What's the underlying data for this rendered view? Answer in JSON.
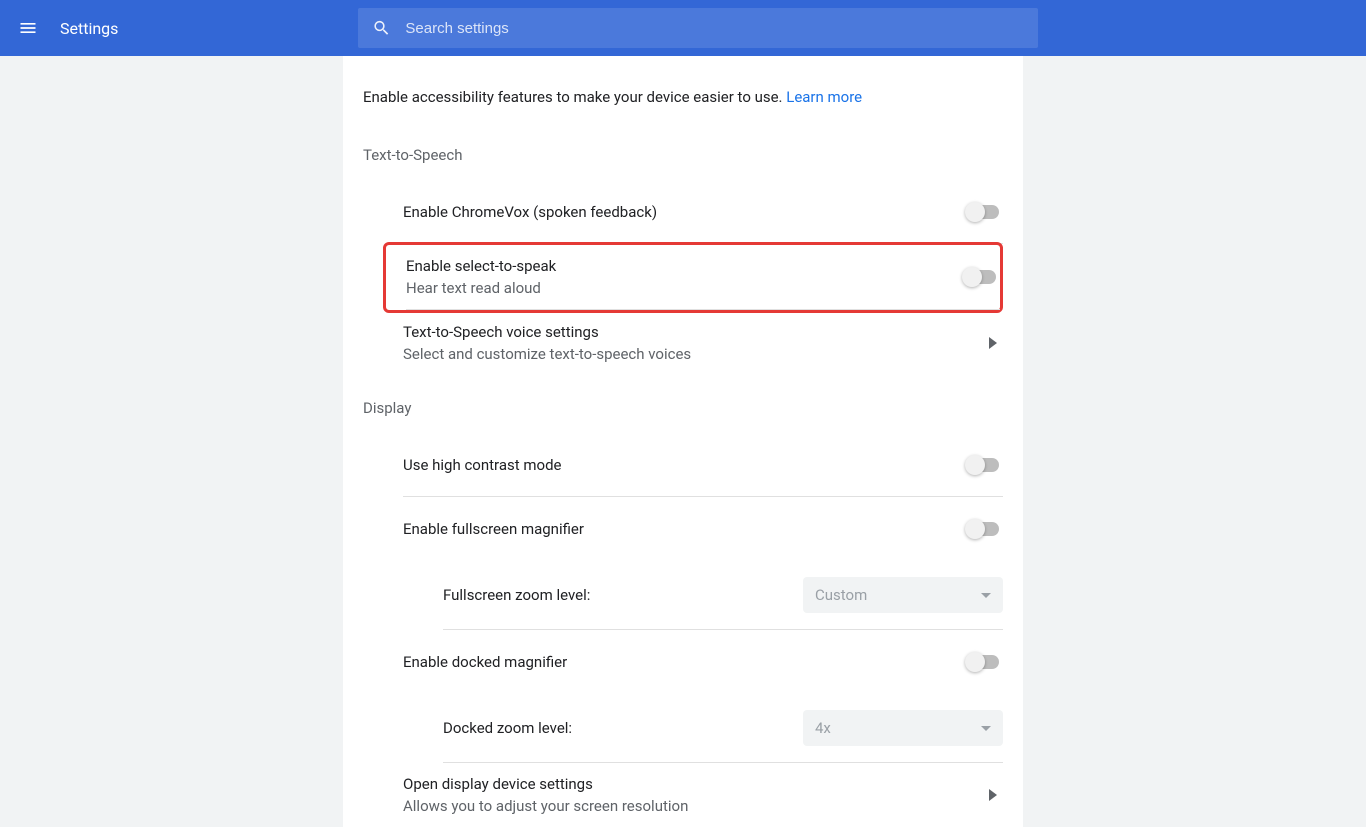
{
  "header": {
    "title": "Settings",
    "search_placeholder": "Search settings"
  },
  "intro": {
    "text": "Enable accessibility features to make your device easier to use. ",
    "link": "Learn more"
  },
  "sections": {
    "tts": {
      "heading": "Text-to-Speech",
      "chromevox": {
        "label": "Enable ChromeVox (spoken feedback)"
      },
      "select_to_speak": {
        "label": "Enable select-to-speak",
        "sub": "Hear text read aloud"
      },
      "voice_settings": {
        "label": "Text-to-Speech voice settings",
        "sub": "Select and customize text-to-speech voices"
      }
    },
    "display": {
      "heading": "Display",
      "high_contrast": {
        "label": "Use high contrast mode"
      },
      "fullscreen_magnifier": {
        "label": "Enable fullscreen magnifier"
      },
      "fullscreen_zoom": {
        "label": "Fullscreen zoom level:",
        "value": "Custom"
      },
      "docked_magnifier": {
        "label": "Enable docked magnifier"
      },
      "docked_zoom": {
        "label": "Docked zoom level:",
        "value": "4x"
      },
      "display_settings": {
        "label": "Open display device settings",
        "sub": "Allows you to adjust your screen resolution"
      }
    }
  }
}
